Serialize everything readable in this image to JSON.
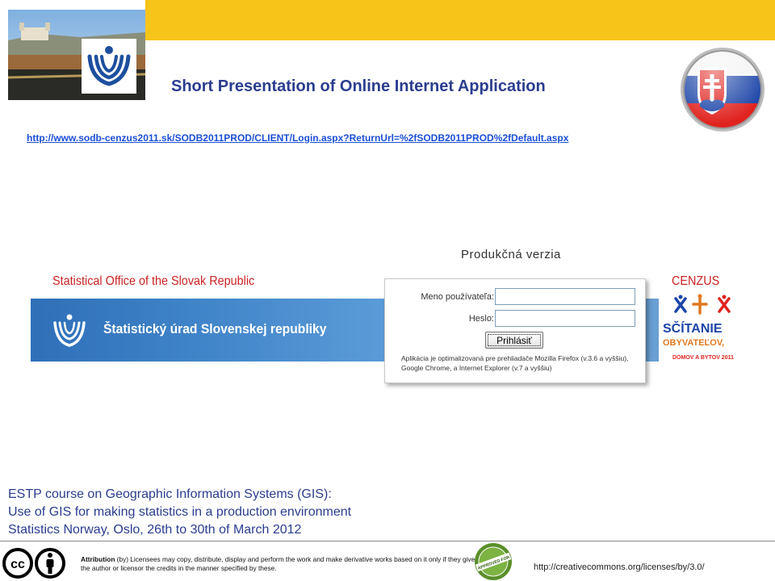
{
  "colors": {
    "top_band": "#f7c51a",
    "title_blue": "#2a3d8f",
    "link_blue": "#1a4fd6",
    "label_red": "#cc2222",
    "banner_blue": "#2f6fb8"
  },
  "header": {
    "title": "Short Presentation of Online Internet Application",
    "link": "http://www.sodb-cenzus2011.sk/SODB2011PROD/CLIENT/Login.aspx?ReturnUrl=%2fSODB2011PROD%2fDefault.aspx",
    "photo_icon": "bratislava-castle-photo",
    "logo_icon": "sodb-logo-icon",
    "flag_icon": "slovakia-flag-icon"
  },
  "labels": {
    "office": "Statistical Office of the Slovak Republic",
    "cenzus": "CENZUS"
  },
  "banner": {
    "text": "Štatistický úrad Slovenskej republiky"
  },
  "login": {
    "heading": "Produkčná verzia",
    "username_label": "Meno používateľa:",
    "username_value": "",
    "password_label": "Heslo:",
    "password_value": "",
    "button": "Prihlásiť",
    "note": "Aplikácia je optimalizovaná pre prehliadače Mozilla Firefox (v.3.6 a vyššiu), Google Chrome, a Internet Explorer (v.7 a vyššiu)"
  },
  "sitanie": {
    "line1": "SČÍTANIE",
    "line2": "OBYVATEĽOV,",
    "line3": "DOMOV A BYTOV 2011"
  },
  "course": {
    "line1": "ESTP course on Geographic Information Systems (GIS):",
    "line2": "Use of GIS for making statistics in a production environment",
    "line3": "Statistics Norway, Oslo, 26th to 30th of March 2012"
  },
  "footer": {
    "cc_text": "cc",
    "attribution_bold": "Attribution",
    "attribution_rest": " (by) Licensees may copy, distribute, display and perform the work and make derivative works based on it only if they give the author or licensor the credits in the manner specified by these.",
    "seal_text": "APPROVED FOR",
    "license_url": "http://creativecommons.org/licenses/by/3.0/"
  }
}
